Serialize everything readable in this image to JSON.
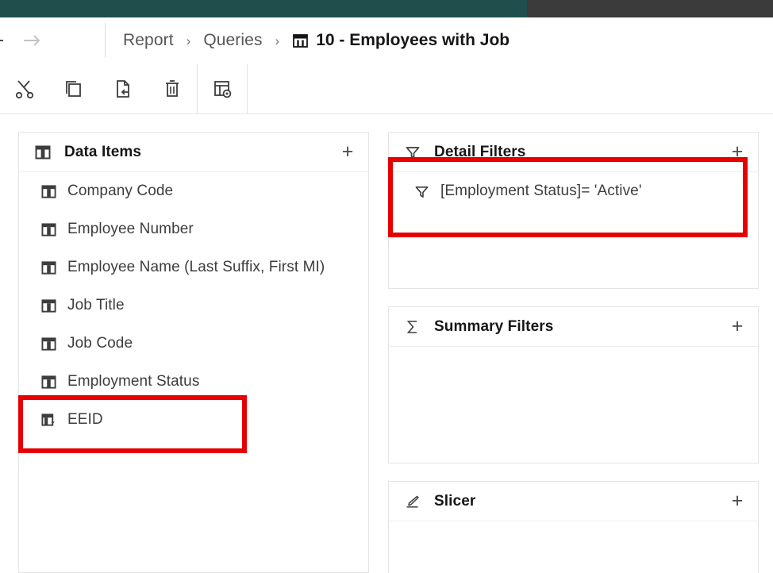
{
  "top_bar": {
    "accent_teal": "#1f4e4d",
    "accent_dark": "#3b3b3b"
  },
  "breadcrumb": {
    "back_label": "Back",
    "forward_label": "Forward",
    "items": [
      {
        "label": "Report",
        "icon": ""
      },
      {
        "label": "Queries",
        "icon": ""
      }
    ],
    "separator": "›",
    "current": {
      "label": "10 - Employees with Job",
      "icon": "query-icon"
    }
  },
  "toolbar": {
    "buttons": [
      {
        "name": "cut-button",
        "icon": "scissors-icon",
        "label": "Cut"
      },
      {
        "name": "copy-button",
        "icon": "copy-icon",
        "label": "Copy"
      },
      {
        "name": "paste-button",
        "icon": "paste-icon",
        "label": "Paste"
      },
      {
        "name": "delete-button",
        "icon": "trash-icon",
        "label": "Delete"
      },
      {
        "name": "properties-button",
        "icon": "table-properties-icon",
        "label": "Properties"
      }
    ]
  },
  "panels": {
    "data_items": {
      "title": "Data Items",
      "icon": "data-item-icon",
      "add_label": "+",
      "items": [
        {
          "label": "Company Code",
          "icon": "data-item-icon"
        },
        {
          "label": "Employee Number",
          "icon": "data-item-icon"
        },
        {
          "label": "Employee Name (Last Suffix, First MI)",
          "icon": "data-item-icon"
        },
        {
          "label": "Job Title",
          "icon": "data-item-icon"
        },
        {
          "label": "Job Code",
          "icon": "data-item-icon"
        },
        {
          "label": "Employment Status",
          "icon": "data-item-icon"
        },
        {
          "label": "EEID",
          "icon": "calculated-data-item-icon"
        }
      ]
    },
    "detail_filters": {
      "title": "Detail Filters",
      "icon": "funnel-icon",
      "add_label": "+",
      "filters": [
        {
          "label": "[Employment Status]= 'Active'",
          "icon": "funnel-icon"
        }
      ]
    },
    "summary_filters": {
      "title": "Summary Filters",
      "icon": "sigma-icon",
      "add_label": "+",
      "filters": []
    },
    "slicer": {
      "title": "Slicer",
      "icon": "slicer-icon",
      "add_label": "+",
      "items": []
    }
  },
  "annotations": {
    "color": "#e60000",
    "boxes": [
      {
        "name": "detail-filter-highlight",
        "target": "[Employment Status]= 'Active'"
      },
      {
        "name": "eeid-highlight",
        "target": "EEID"
      }
    ]
  }
}
